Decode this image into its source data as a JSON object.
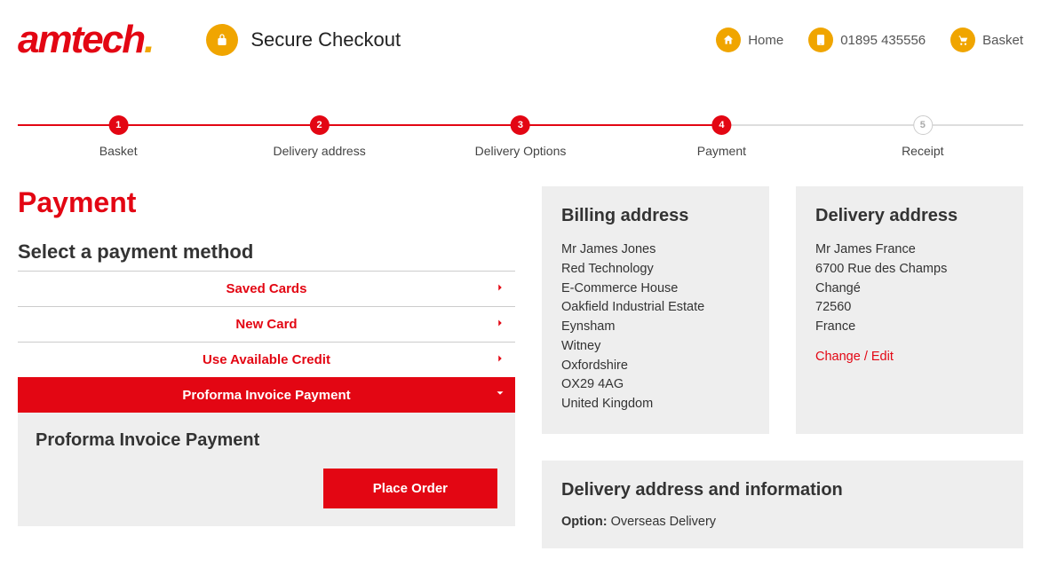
{
  "brand": {
    "name": "amtech",
    "dot": "."
  },
  "header": {
    "secure_label": "Secure Checkout",
    "home_label": "Home",
    "phone_label": "01895 435556",
    "basket_label": "Basket"
  },
  "steps": [
    {
      "num": "1",
      "label": "Basket",
      "pos": 10,
      "active": true
    },
    {
      "num": "2",
      "label": "Delivery address",
      "pos": 30,
      "active": true
    },
    {
      "num": "3",
      "label": "Delivery Options",
      "pos": 50,
      "active": true
    },
    {
      "num": "4",
      "label": "Payment",
      "pos": 70,
      "active": true
    },
    {
      "num": "5",
      "label": "Receipt",
      "pos": 90,
      "active": false
    }
  ],
  "progress_fill_pct": 70,
  "page_title": "Payment",
  "select_heading": "Select a payment method",
  "accordion": {
    "saved_cards": "Saved Cards",
    "new_card": "New Card",
    "credit": "Use Available Credit",
    "proforma": "Proforma Invoice Payment"
  },
  "proforma_panel": {
    "title": "Proforma Invoice Payment",
    "place_order_btn": "Place Order"
  },
  "billing": {
    "heading": "Billing address",
    "lines": [
      "Mr James Jones",
      "Red Technology",
      "E-Commerce House",
      "Oakfield Industrial Estate",
      "Eynsham",
      "Witney",
      "Oxfordshire",
      "OX29 4AG",
      "United Kingdom"
    ]
  },
  "delivery": {
    "heading": "Delivery address",
    "lines": [
      "Mr James France",
      "6700 Rue des Champs",
      "Changé",
      "72560",
      "France"
    ],
    "change_label": "Change / Edit"
  },
  "delivery_info": {
    "heading": "Delivery address and information",
    "option_label": "Option:",
    "option_value": "Overseas Delivery"
  }
}
